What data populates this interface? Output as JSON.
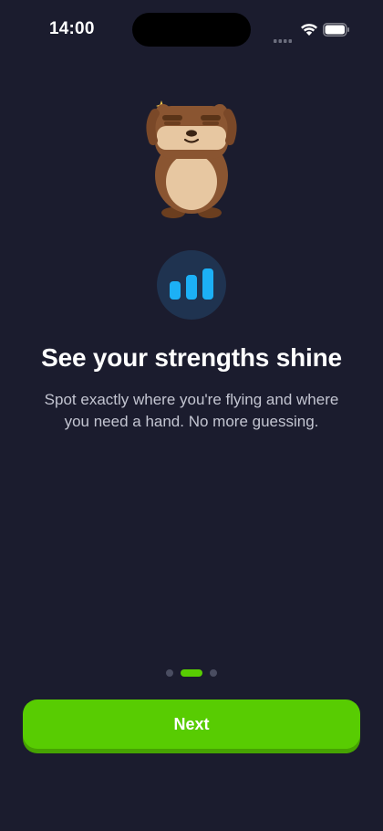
{
  "status_bar": {
    "time": "14:00",
    "icons": [
      "cellular-signal-icon",
      "wifi-icon",
      "battery-icon"
    ]
  },
  "illustration": {
    "mascot": "bear-mascot",
    "badge_icon": "bar-chart-icon"
  },
  "content": {
    "title": "See your strengths shine",
    "description": "Spot exactly where you're flying and where you need a hand. No more guessing."
  },
  "pager": {
    "total_pages": 3,
    "current_page": 2
  },
  "actions": {
    "next_label": "Next"
  },
  "colors": {
    "background": "#1b1c2e",
    "accent": "#58cc02",
    "badge_background": "#1f3350",
    "chart_icon": "#1cb0f6"
  }
}
